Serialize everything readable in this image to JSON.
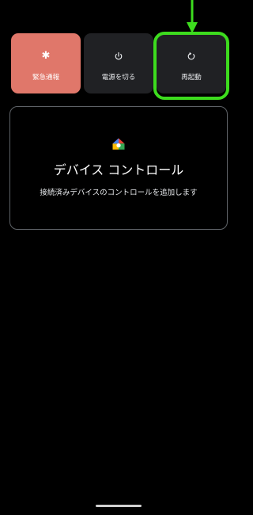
{
  "power_menu": {
    "tiles": [
      {
        "label": "緊急通報",
        "icon": "asterisk-icon"
      },
      {
        "label": "電源を切る",
        "icon": "power-icon"
      },
      {
        "label": "再起動",
        "icon": "restart-icon"
      }
    ]
  },
  "device_controls": {
    "title": "デバイス コントロール",
    "subtitle": "接続済みデバイスのコントロールを追加します",
    "icon": "google-home-icon"
  },
  "colors": {
    "emergency_tile": "#e0776a",
    "tile_background": "#202124",
    "highlight": "#3ddc1e",
    "card_border": "#5f6368"
  }
}
